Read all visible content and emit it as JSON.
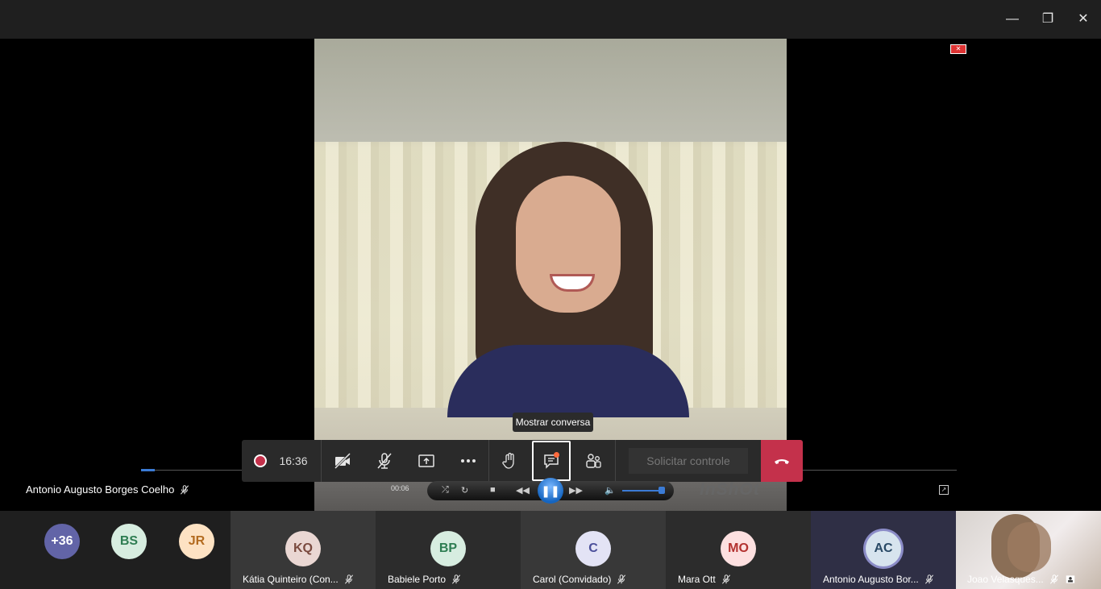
{
  "window": {
    "minimize": "—",
    "maximize": "❐",
    "close": "✕"
  },
  "tooltip": "Mostrar conversa",
  "callbar": {
    "timer": "16:36",
    "request_control": "Solicitar controle"
  },
  "speaker": {
    "name": "Antonio Augusto Borges Coelho"
  },
  "media": {
    "time": "00:06",
    "watermark": "InShOt"
  },
  "participants": [
    {
      "initials": "+36",
      "color": "#6264a7",
      "text_color": "#ffffff"
    },
    {
      "initials": "BS",
      "color": "#d7ede0",
      "text_color": "#2e7d52"
    },
    {
      "initials": "JR",
      "color": "#fde2c3",
      "text_color": "#b36b1f"
    },
    {
      "initials": "KQ",
      "color": "#ead7d3",
      "text_color": "#7a4a3f",
      "name": "Kátia Quinteiro (Con..."
    },
    {
      "initials": "BP",
      "color": "#d7ede0",
      "text_color": "#2e7d52",
      "name": "Babiele Porto"
    },
    {
      "initials": "C",
      "color": "#e3e3f5",
      "text_color": "#4b4f9a",
      "name": "Carol (Convidado)"
    },
    {
      "initials": "MO",
      "color": "#fde0e0",
      "text_color": "#b3312f",
      "name": "Mara Ott"
    },
    {
      "initials": "AC",
      "color": "#d7e4ee",
      "text_color": "#2a4a66",
      "name": "Antonio Augusto Bor..."
    },
    {
      "name": "Joao Velasques..."
    }
  ]
}
